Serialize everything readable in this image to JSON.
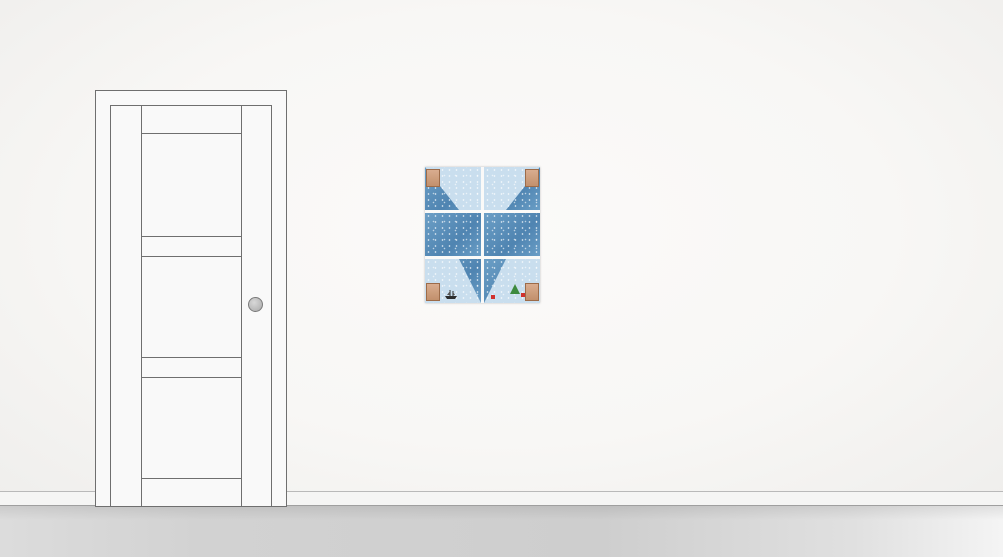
{
  "scene": {
    "wall_color": "#f9f8f7",
    "floor_color": "#d0d0d0",
    "door_color": "#f9f9f9",
    "outline_color": "#6f6f6f",
    "knob_color": "#b7b7b7",
    "poster_colors": {
      "primary": "#4f84b1",
      "light": "#b9d5e8",
      "label": "#c2906c",
      "tree": "#3d8a3f",
      "accent": "#d0312d"
    }
  }
}
